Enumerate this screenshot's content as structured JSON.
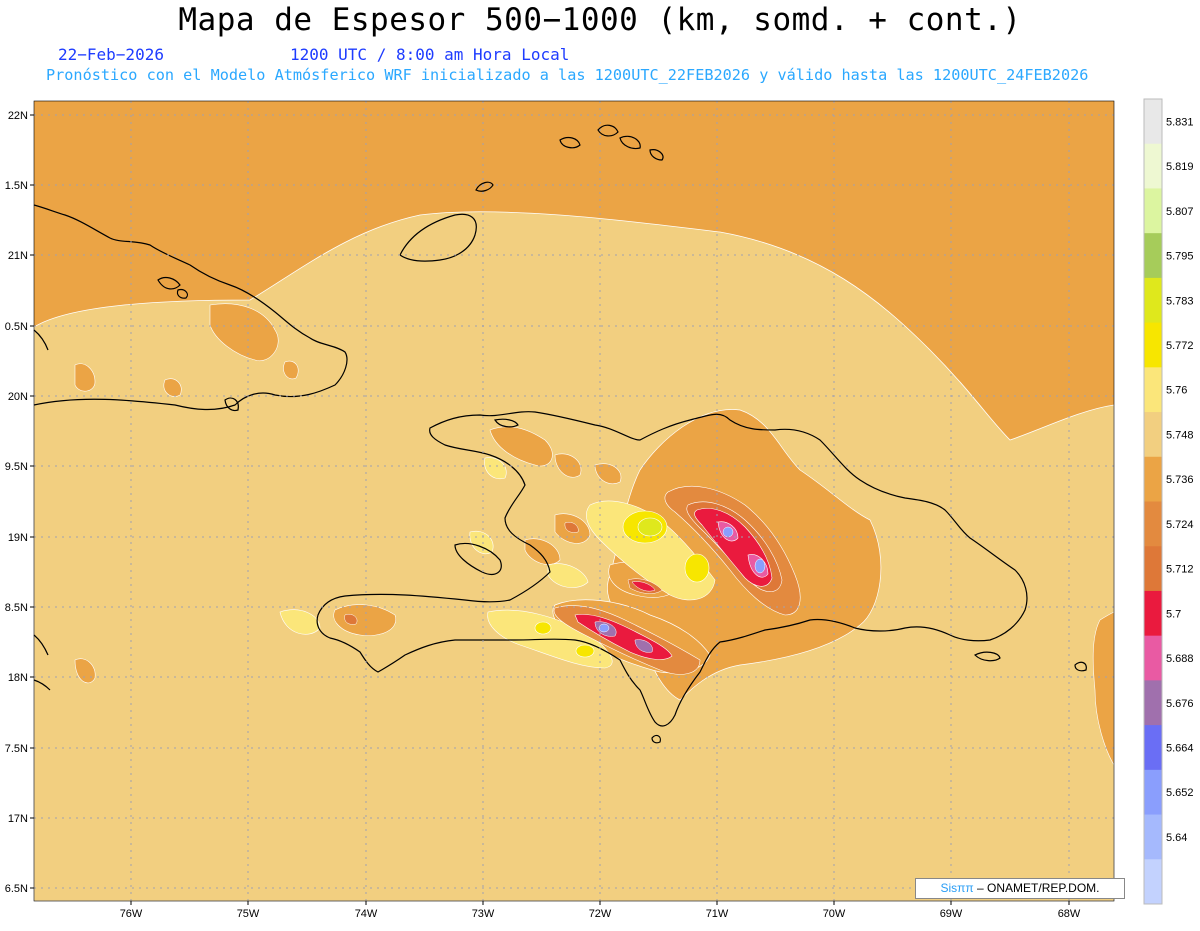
{
  "header": {
    "title": "Mapa de Espesor 500−1000 (km, somd. + cont.)",
    "date": "22−Feb−2026",
    "time": "1200 UTC / 8:00 am Hora Local",
    "forecast": "Pronóstico con el Modelo Atmósferico WRF inicializado a las 1200UTC_22FEB2026 y válido hasta las  1200UTC_24FEB2026"
  },
  "axes": {
    "lat_labels": [
      "22N",
      "1.5N",
      "21N",
      "0.5N",
      "20N",
      "9.5N",
      "19N",
      "8.5N",
      "18N",
      "7.5N",
      "17N",
      "6.5N"
    ],
    "lon_labels": [
      "76W",
      "75W",
      "74W",
      "73W",
      "72W",
      "71W",
      "70W",
      "69W",
      "68W"
    ]
  },
  "colorbar": {
    "labels": [
      "5.831",
      "5.819",
      "5.807",
      "5.795",
      "5.783",
      "5.772",
      "5.76",
      "5.748",
      "5.736",
      "5.724",
      "5.712",
      "5.7",
      "5.688",
      "5.676",
      "5.664",
      "5.652",
      "5.64"
    ],
    "colors": [
      "#e8e8e8",
      "#eef8d2",
      "#dcf5a0",
      "#a6cc5a",
      "#dfe81c",
      "#f7e600",
      "#fbe67a",
      "#f2cf80",
      "#eba445",
      "#e38a3f",
      "#de7838",
      "#ea1a3e",
      "#e95aa3",
      "#a070ad",
      "#6a6ef5",
      "#8a9efd",
      "#a5b9fd",
      "#c3d2fe"
    ]
  },
  "credit": {
    "brand": "Sisππ",
    "text": " – ONAMET/REP.DOM."
  }
}
